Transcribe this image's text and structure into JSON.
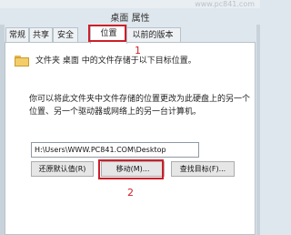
{
  "watermark": "www.pc841.com",
  "window": {
    "title": "桌面 属性"
  },
  "tabs": [
    {
      "label": "常规",
      "active": false
    },
    {
      "label": "共享",
      "active": false
    },
    {
      "label": "安全",
      "active": false
    },
    {
      "label": "位置",
      "active": true
    },
    {
      "label": "以前的版本",
      "active": false
    }
  ],
  "location": {
    "description": "文件夹 桌面 中的文件存储于以下目标位置。",
    "info_line1": "你可以将此文件夹中文件存储的位置更改为此硬盘上的另一个",
    "info_line2": "位置、另一个驱动器或网络上的另一台计算机。",
    "path_value": "H:\\Users\\WWW.PC841.COM\\Desktop",
    "buttons": {
      "restore": "还原默认值(R)",
      "move": "移动(M)...",
      "find_target": "查找目标(F)..."
    }
  },
  "annotations": {
    "marker1": "1",
    "marker2": "2",
    "highlight_color": "#cc1f28"
  }
}
